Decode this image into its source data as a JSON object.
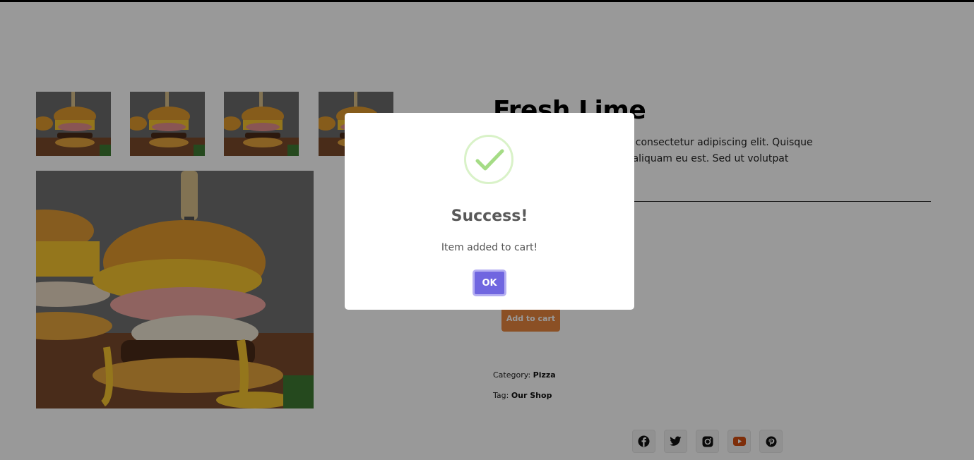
{
  "product": {
    "title": "Fresh Lime",
    "description": "Lorem ipsum dolor sit amet, consectetur adipiscing elit. Quisque diam lorem, consectetur id, aliquam eu est. Sed ut volutpat fringilla bibendum.",
    "add_to_cart_label": "Add to cart",
    "category_label": "Category:",
    "category_value": "Pizza",
    "tag_label": "Tag:",
    "tag_value": "Our Shop"
  },
  "gallery": {
    "thumbnails": [
      "burger-thumbnail-1",
      "burger-thumbnail-2",
      "burger-thumbnail-3",
      "burger-thumbnail-4"
    ],
    "main_image": "burger-main-image"
  },
  "social": [
    "facebook-icon",
    "twitter-icon",
    "instagram-icon",
    "youtube-icon",
    "pinterest-icon"
  ],
  "colors": {
    "accent": "#e8853e",
    "youtube": "#d24e12",
    "ok_button": "#7066e0",
    "success_check": "#a5dc86"
  },
  "modal": {
    "title": "Success!",
    "text": "Item added to cart!",
    "ok_label": "OK",
    "icon": "success-check-icon"
  }
}
